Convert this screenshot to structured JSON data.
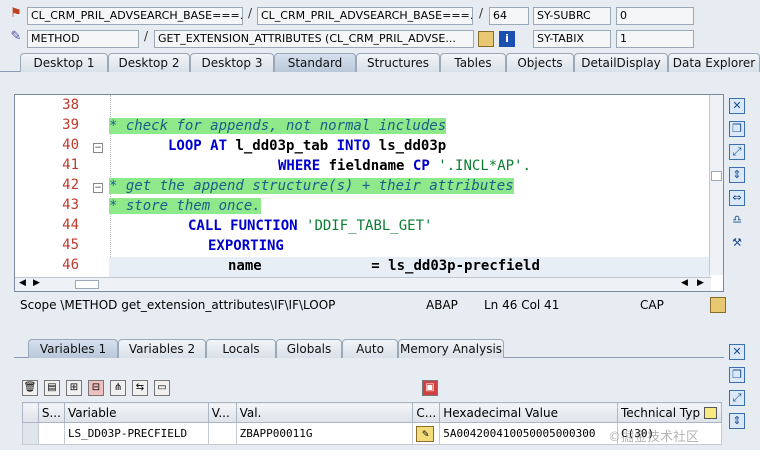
{
  "header": {
    "program1": "CL_CRM_PRIL_ADVSEARCH_BASE===...",
    "program2": "CL_CRM_PRIL_ADVSEARCH_BASE===...",
    "line_no": "64",
    "event_type": "METHOD",
    "event_name": "GET_EXTENSION_ATTRIBUTES (CL_CRM_PRIL_ADVSE...",
    "sy_subrc_label": "SY-SUBRC",
    "sy_subrc_value": "0",
    "sy_tabix_label": "SY-TABIX",
    "sy_tabix_value": "1"
  },
  "tabs": [
    "Desktop 1",
    "Desktop 2",
    "Desktop 3",
    "Standard",
    "Structures",
    "Tables",
    "Objects",
    "DetailDisplay",
    "Data Explorer"
  ],
  "active_tab": "Standard",
  "editor": {
    "line_numbers": [
      "38",
      "39",
      "40",
      "41",
      "42",
      "43",
      "44",
      "45",
      "46"
    ],
    "l39": "* check for appends, not normal includes",
    "l40_kw1": "LOOP AT",
    "l40_var1": "l_dd03p_tab",
    "l40_kw2": "INTO",
    "l40_var2": "ls_dd03p",
    "l41_kw": "WHERE",
    "l41_var": "fieldname",
    "l41_op": "CP",
    "l41_str": "'.INCL*AP'.",
    "l42": "* get the append structure(s) + their attributes",
    "l43": "* store them once.",
    "l44_kw": "CALL FUNCTION",
    "l44_str": "'DDIF_TABL_GET'",
    "l45_kw": "EXPORTING",
    "l46_var": "name",
    "l46_op": "=",
    "l46_val": "ls_dd03p-precfield"
  },
  "status": {
    "scope": "Scope \\METHOD get_extension_attributes\\IF\\IF\\LOOP",
    "lang": "ABAP",
    "pos": "Ln  46 Col  41",
    "caps": "CAP"
  },
  "bottom_tabs": [
    "Variables 1",
    "Variables 2",
    "Locals",
    "Globals",
    "Auto",
    "Memory Analysis"
  ],
  "active_bottom_tab": "Variables 1",
  "grid": {
    "headers": [
      "S...",
      "Variable",
      "V...",
      "Val.",
      "C...",
      "Hexadecimal Value",
      "Technical Typ"
    ],
    "row": {
      "variable": "LS_DD03P-PRECFIELD",
      "value": "ZBAPP00011G",
      "hex": "5A004200410050005000300",
      "type": "C(30)"
    }
  },
  "watermark": "©掘金技术社区"
}
